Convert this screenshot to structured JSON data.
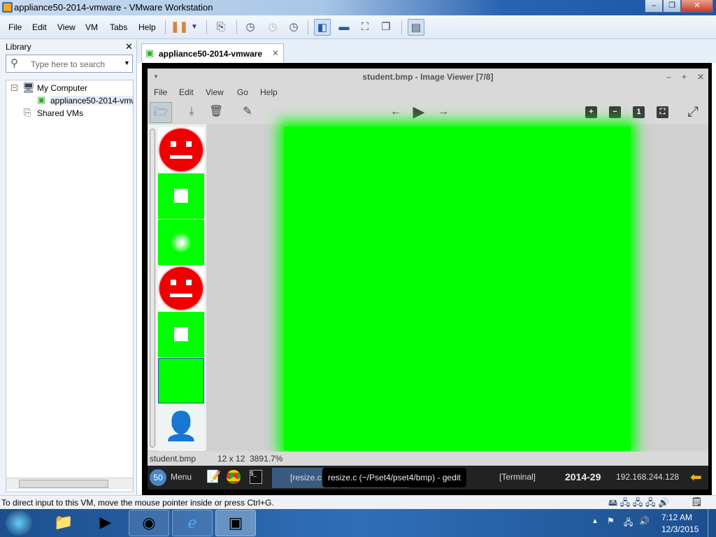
{
  "window": {
    "title": "appliance50-2014-vmware - VMware Workstation"
  },
  "menubar": {
    "items": [
      "File",
      "Edit",
      "View",
      "VM",
      "Tabs",
      "Help"
    ]
  },
  "library": {
    "title": "Library",
    "search_placeholder": "Type here to search",
    "tree": [
      "My Computer",
      "appliance50-2014-vmware",
      "Shared VMs"
    ]
  },
  "tabs": [
    {
      "label": "appliance50-2014-vmware"
    }
  ],
  "viewer": {
    "title": "student.bmp - Image Viewer [7/8]",
    "menu": [
      "File",
      "Edit",
      "View",
      "Go",
      "Help"
    ],
    "status": {
      "filename": "student.bmp",
      "dimensions": "12 x 12",
      "zoom": "3891.7%"
    },
    "image_color": "#00ff00"
  },
  "guest_panel": {
    "menu_badge": "50",
    "menu_label": "Menu",
    "task1": "[resize.c",
    "tooltip": "resize.c (~/Pset4/pset4/bmp) - gedit",
    "task3": "[Terminal]",
    "workspace": "2014-29",
    "ip": "192.168.244.128"
  },
  "statusbar": {
    "message": "To direct input to this VM, move the mouse pointer inside or press Ctrl+G."
  },
  "taskbar": {
    "time": "7:12 AM",
    "date": "12/3/2015"
  }
}
